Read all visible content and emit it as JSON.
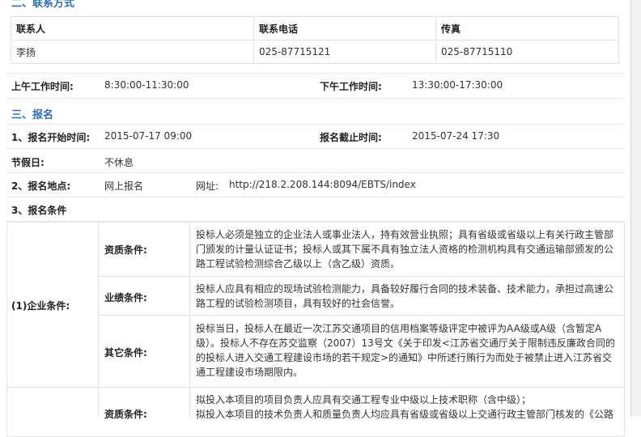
{
  "contact": {
    "section_title": "二、联系方式",
    "headers": [
      "联系人",
      "联系电话",
      "传真"
    ],
    "row": [
      "李扬",
      "025-87715121",
      "025-87715110"
    ]
  },
  "work_hours": {
    "am_label": "上午工作时间:",
    "am_value": "8:30:00-11:30:00",
    "pm_label": "下午工作时间:",
    "pm_value": "13:30:00-17:30:00"
  },
  "registration": {
    "section_title": "三、报名",
    "start_label": "1、报名开始时间:",
    "start_value": "2015-07-17 09:00",
    "end_label": "报名截止时间:",
    "end_value": "2015-07-24 17:30",
    "holiday_label": "节假日:",
    "holiday_value": "不休息",
    "location_label": "2、报名地点:",
    "location_value": "网上报名",
    "url_label": "网址:",
    "url_value": "http://218.2.208.144:8094/EBTS/index",
    "conditions_label": "3、报名条件"
  },
  "enterprise": {
    "label": "(1)企业条件:",
    "items": [
      {
        "name": "资质条件:",
        "lines": [
          "投标人必须是独立的企业法人或事业法人，持有效营业执照；具有省级或省级以上有关行政主管部",
          "门颁发的计量认证证书；投标人或其下属不具有独立法人资格的检测机构具有交通运输部颁发的公",
          "路工程试验检测综合乙级以上（含乙级）资质。"
        ]
      },
      {
        "name": "业绩条件:",
        "lines": [
          "投标人应具有相应的现场试验检测能力，具备较好履行合同的技术装备、技术能力，承担过高速公",
          "路工程的试验检测项目，具有较好的社会信誉。"
        ]
      },
      {
        "name": "其它条件:",
        "lines": [
          "投标当日，投标人在最近一次江苏交通项目的信用档案等级评定中被评为AA级或A级（含暂定A",
          "级）。投标人不存在苏交监察（2007）13号文《关于印发<江苏省交通厅关于限制违反廉政合同的",
          "的投标人进入交通工程建设市场的若干规定>的通知》中所述行贿行为而处于被禁止进入江苏省交",
          "通工程建设市场期限内。"
        ]
      }
    ]
  },
  "personnel": {
    "name": "资质条件:",
    "lines": [
      "拟投入本项目的项目负责人应具有交通工程专业中级以上技术职称（含中级）；",
      "拟投入本项目的技术负责人和质量负责人均应具有省级或省级以上交通行政主管部门核发的《公路"
    ]
  }
}
